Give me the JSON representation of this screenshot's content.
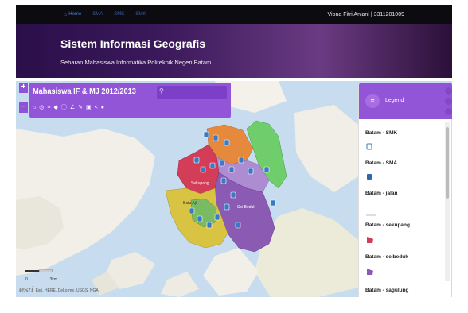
{
  "topnav": {
    "items": [
      {
        "label": "Home",
        "active": true
      },
      {
        "label": "SMA"
      },
      {
        "label": "SMK"
      },
      {
        "label": "SMK"
      }
    ],
    "user": "Viona Fitri Anjani | 3311201009"
  },
  "header": {
    "title": "Sistem Informasi Geografis",
    "subtitle": "Sebaran Mahasiswa Informatika Politeknik Negeri Batam"
  },
  "map": {
    "title": "Mahasiswa IF & MJ 2012/2013",
    "zoom_in": "+",
    "zoom_out": "−",
    "toolbar_icons": [
      "home-icon",
      "globe-icon",
      "list-icon",
      "layers-icon",
      "info-icon",
      "measure-icon",
      "draw-icon",
      "print-icon",
      "share-icon",
      "lock-icon"
    ],
    "place_labels": [
      "Sekupang",
      "Batu Aji",
      "Sei Beduk"
    ],
    "scale": {
      "left": "0",
      "right": "3km"
    },
    "attribution": "Esri, HERE, DeLorme, USGS, NGA",
    "logo": "esri"
  },
  "legend": {
    "title": "Legend",
    "items": [
      {
        "label": "Batam - SMK",
        "symbol": "school-icon",
        "color": "#3b79c4"
      },
      {
        "label": "Batam - SMA",
        "symbol": "school-icon",
        "color": "#2f67ad"
      },
      {
        "label": "Batam - jalan",
        "symbol": "line",
        "color": "#bbbbbb"
      },
      {
        "label": "Batam - sekupang",
        "symbol": "polygon",
        "color": "#d43d58"
      },
      {
        "label": "Batam - seibeduk",
        "symbol": "polygon",
        "color": "#8b5ab2"
      },
      {
        "label": "Batam - sagulung",
        "symbol": "polygon",
        "color": "#d9c342"
      }
    ]
  },
  "colors": {
    "accent": "#9355d8",
    "nav_bg": "#0c0c10",
    "sekupang": "#d43d58",
    "seibeduk": "#8b5ab2",
    "sagulung": "#d9c342",
    "nongsa": "#6fcd6b",
    "batuampar": "#e58a3d",
    "center": "#ae8cd2"
  }
}
